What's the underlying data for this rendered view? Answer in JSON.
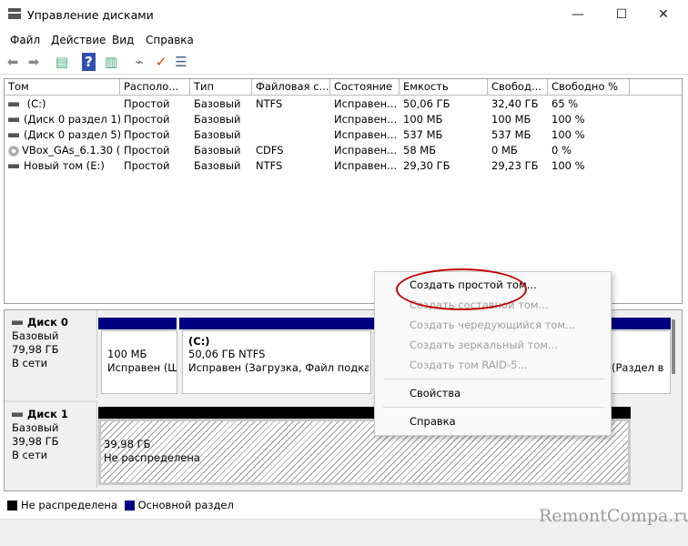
{
  "window": {
    "title": "Управление дисками",
    "minimize": "—",
    "maximize": "☐",
    "close": "✕"
  },
  "menu": [
    "Файл",
    "Действие",
    "Вид",
    "Справка"
  ],
  "toolbar": {
    "icons": [
      "back-icon",
      "forward-icon",
      "console-tree-icon",
      "help-icon",
      "action-pane-icon",
      "connect-icon",
      "properties-icon",
      "list-icon"
    ]
  },
  "table": {
    "columns": [
      "Том",
      "Располо...",
      "Тип",
      "Файловая с...",
      "Состояние",
      "Емкость",
      "Свобод...",
      "Свободно %"
    ],
    "rows": [
      {
        "icon": "drive",
        "cells": [
          " (C:)",
          "Простой",
          "Базовый",
          "NTFS",
          "Исправен...",
          "50,06 ГБ",
          "32,40 ГБ",
          "65 %"
        ]
      },
      {
        "icon": "drive",
        "cells": [
          "(Диск 0 раздел 1)",
          "Простой",
          "Базовый",
          "",
          "Исправен...",
          "100 МБ",
          "100 МБ",
          "100 %"
        ]
      },
      {
        "icon": "drive",
        "cells": [
          "(Диск 0 раздел 5)",
          "Простой",
          "Базовый",
          "",
          "Исправен...",
          "537 МБ",
          "537 МБ",
          "100 %"
        ]
      },
      {
        "icon": "cdrom",
        "cells": [
          "VBox_GAs_6.1.30 (...",
          "Простой",
          "Базовый",
          "CDFS",
          "Исправен...",
          "58 МБ",
          "0 МБ",
          "0 %"
        ]
      },
      {
        "icon": "drive",
        "cells": [
          "Новый том (E:)",
          "Простой",
          "Базовый",
          "NTFS",
          "Исправен...",
          "29,30 ГБ",
          "29,23 ГБ",
          "100 %"
        ]
      }
    ]
  },
  "disks": [
    {
      "name": "Диск 0",
      "type": "Базовый",
      "size": "79,98 ГБ",
      "status": "В сети",
      "partitions": [
        {
          "title": "",
          "line1": "100 МБ",
          "line2": "Исправен (Ш"
        },
        {
          "title": "(C:)",
          "line1": "50,06 ГБ NTFS",
          "line2": "Исправен (Загрузка, Файл подкачк"
        },
        {
          "title": "",
          "line1": "",
          "line2": "(Раздел в"
        }
      ]
    },
    {
      "name": "Диск 1",
      "type": "Базовый",
      "size": "39,98 ГБ",
      "status": "В сети",
      "partitions": [
        {
          "line1": "39,98 ГБ",
          "line2": "Не распределена"
        }
      ]
    }
  ],
  "legend": [
    {
      "label": "Не распределена",
      "color": "#000000"
    },
    {
      "label": "Основной раздел",
      "color": "#000080"
    }
  ],
  "context_menu": {
    "items": [
      {
        "label": "Создать простой том...",
        "enabled": true
      },
      {
        "label": "Создать составной том...",
        "enabled": false
      },
      {
        "label": "Создать чередующийся том...",
        "enabled": false
      },
      {
        "label": "Создать зеркальный том...",
        "enabled": false
      },
      {
        "label": "Создать том RAID-5...",
        "enabled": false
      },
      {
        "label": "Свойства",
        "enabled": true
      },
      {
        "label": "Справка",
        "enabled": true
      }
    ]
  },
  "watermark": "RemontCompa.ru",
  "colors": {
    "primary_partition": "#000080",
    "unallocated": "#000000",
    "highlight": "#c00000"
  }
}
